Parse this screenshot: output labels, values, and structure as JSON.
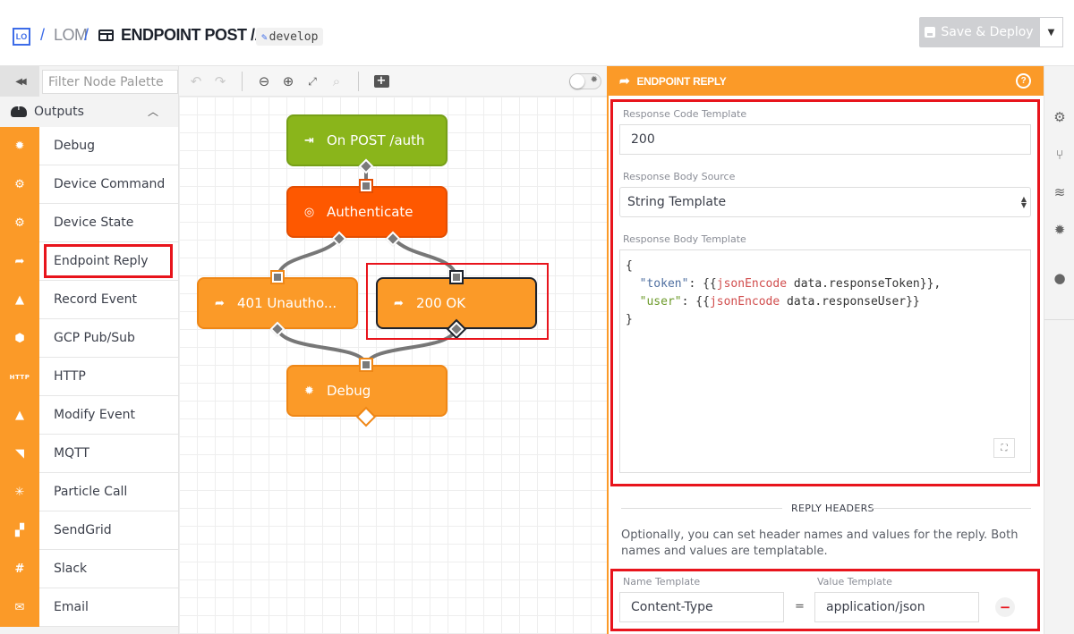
{
  "header": {
    "logo_text": "LO",
    "breadcrumb_sep": "/",
    "app_name": "LOM",
    "flow_title": "ENDPOINT POST /AUTH",
    "branch": "develop",
    "save_deploy_label": "Save & Deploy"
  },
  "palette": {
    "filter_placeholder": "Filter Node Palette",
    "section_title": "Outputs",
    "items": [
      {
        "label": "Debug",
        "icon": "bug-icon",
        "glyph": "✹"
      },
      {
        "label": "Device Command",
        "icon": "device-command-icon",
        "glyph": "⚙"
      },
      {
        "label": "Device State",
        "icon": "device-state-icon",
        "glyph": "⚙"
      },
      {
        "label": "Endpoint Reply",
        "icon": "endpoint-reply-icon",
        "glyph": "➦"
      },
      {
        "label": "Record Event",
        "icon": "record-event-icon",
        "glyph": "▲"
      },
      {
        "label": "GCP Pub/Sub",
        "icon": "gcp-pubsub-icon",
        "glyph": "⬢"
      },
      {
        "label": "HTTP",
        "icon": "http-icon",
        "glyph": "HTTP"
      },
      {
        "label": "Modify Event",
        "icon": "modify-event-icon",
        "glyph": "▲"
      },
      {
        "label": "MQTT",
        "icon": "mqtt-icon",
        "glyph": "◥"
      },
      {
        "label": "Particle Call",
        "icon": "particle-icon",
        "glyph": "✳"
      },
      {
        "label": "SendGrid",
        "icon": "sendgrid-icon",
        "glyph": "▞"
      },
      {
        "label": "Slack",
        "icon": "slack-icon",
        "glyph": "#"
      },
      {
        "label": "Email",
        "icon": "email-icon",
        "glyph": "✉"
      }
    ]
  },
  "canvas": {
    "nodes": [
      {
        "label": "On POST /auth",
        "type": "trigger",
        "icon": "endpoint-trigger-icon"
      },
      {
        "label": "Authenticate",
        "type": "auth",
        "icon": "fingerprint-icon"
      },
      {
        "label": "401 Unautho...",
        "type": "endpoint-reply",
        "icon": "endpoint-reply-icon"
      },
      {
        "label": "200 OK",
        "type": "endpoint-reply",
        "icon": "endpoint-reply-icon",
        "selected": true
      },
      {
        "label": "Debug",
        "type": "debug",
        "icon": "bug-icon"
      }
    ]
  },
  "panel": {
    "title": "ENDPOINT REPLY",
    "response_code_label": "Response Code Template",
    "response_code_value": "200",
    "body_source_label": "Response Body Source",
    "body_source_value": "String Template",
    "body_template_label": "Response Body Template",
    "body_template_lines": [
      {
        "open": "{"
      },
      {
        "key": "\"token\"",
        "fn": "jsonEncode",
        "arg": "data.responseToken",
        "trail": "}},"
      },
      {
        "key": "\"user\"",
        "fn": "jsonEncode",
        "arg": "data.responseUser",
        "trail": "}}"
      },
      {
        "close": "}"
      }
    ],
    "reply_headers_title": "REPLY HEADERS",
    "reply_headers_help": "Optionally, you can set header names and values for the reply. Both names and values are templatable.",
    "name_template_label": "Name Template",
    "value_template_label": "Value Template",
    "header_name": "Content-Type",
    "header_value": "application/json",
    "equals": "="
  },
  "colors": {
    "accent_orange": "#fb9a28",
    "trigger_green": "#8ab51b",
    "auth_red_orange": "#fe5800",
    "highlight_red": "#e8141c",
    "brand_blue": "#3d6ce8"
  }
}
